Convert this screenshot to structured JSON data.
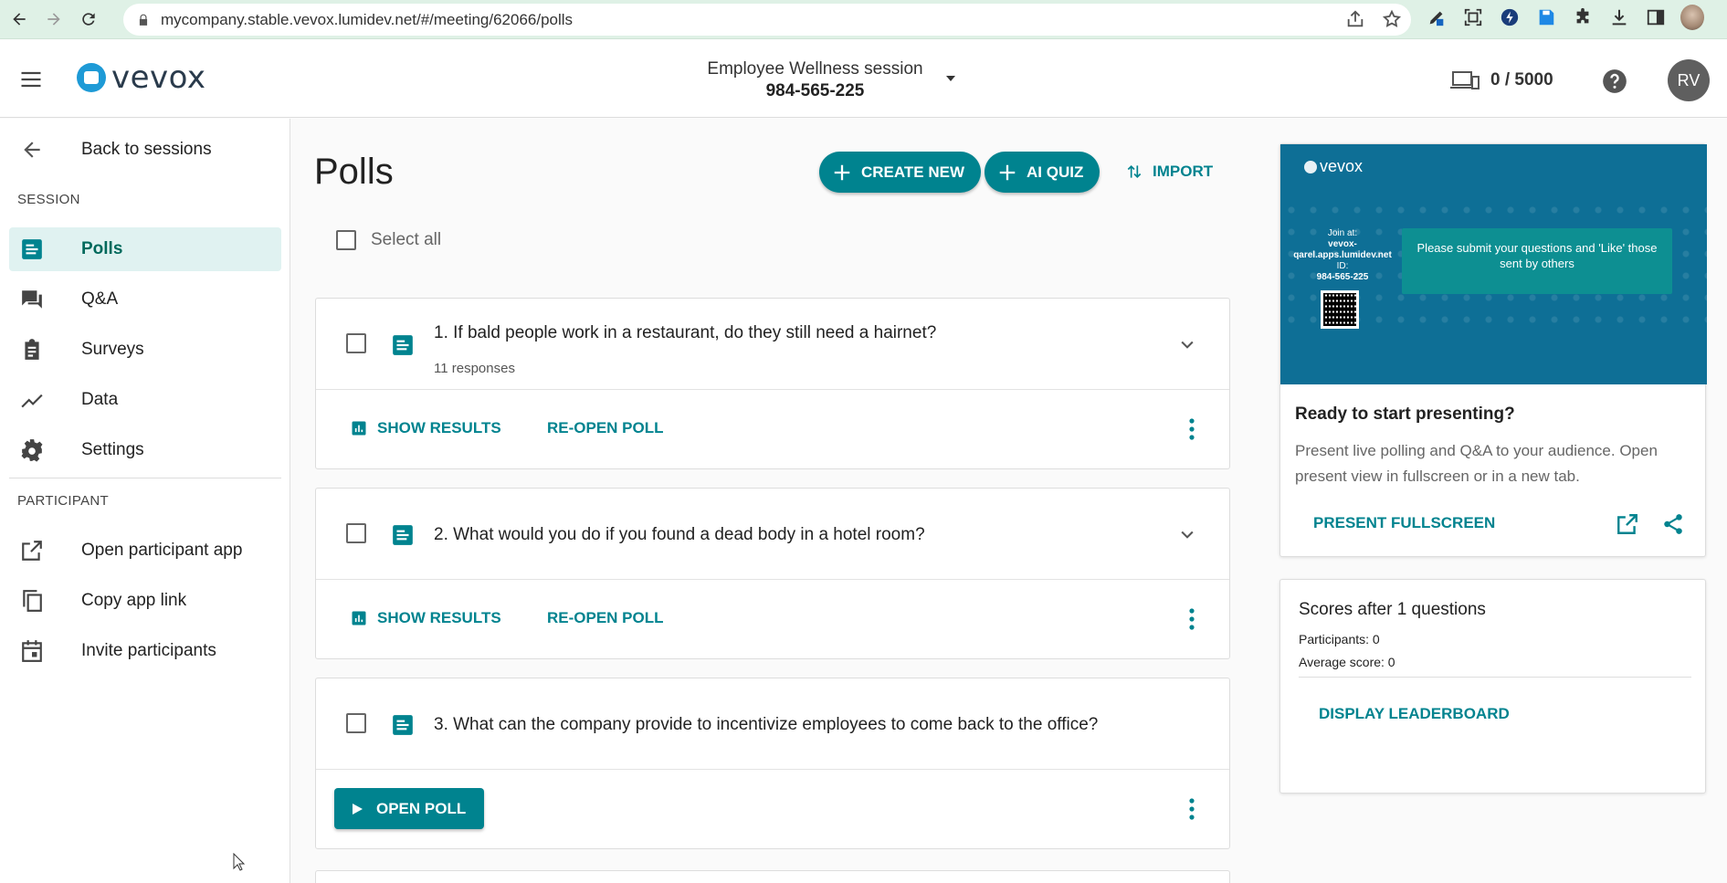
{
  "browser": {
    "url": "mycompany.stable.vevox.lumidev.net/#/meeting/62066/polls"
  },
  "header": {
    "logo_text": "vevox",
    "session_name": "Employee Wellness session",
    "session_code": "984-565-225",
    "devices_count": "0 / 5000",
    "avatar_initials": "RV"
  },
  "sidebar": {
    "back_label": "Back to sessions",
    "session_heading": "SESSION",
    "items": [
      {
        "label": "Polls",
        "icon": "poll-icon"
      },
      {
        "label": "Q&A",
        "icon": "forum-icon"
      },
      {
        "label": "Surveys",
        "icon": "clipboard-icon"
      },
      {
        "label": "Data",
        "icon": "trend-icon"
      },
      {
        "label": "Settings",
        "icon": "gear-icon"
      }
    ],
    "participant_heading": "PARTICIPANT",
    "participant_items": [
      {
        "label": "Open participant app",
        "icon": "open-external-icon"
      },
      {
        "label": "Copy app link",
        "icon": "copy-icon"
      },
      {
        "label": "Invite participants",
        "icon": "calendar-icon"
      }
    ]
  },
  "main": {
    "title": "Polls",
    "create_new_label": "CREATE NEW",
    "ai_quiz_label": "AI QUIZ",
    "import_label": "IMPORT",
    "select_all_label": "Select all",
    "polls": [
      {
        "question": "1. If bald people work in a restaurant, do they still need a hairnet?",
        "responses": "11 responses",
        "show_results": "SHOW RESULTS",
        "reopen": "RE-OPEN POLL"
      },
      {
        "question": "2. What would you do if you found a dead body in a hotel room?",
        "show_results": "SHOW RESULTS",
        "reopen": "RE-OPEN POLL"
      },
      {
        "question": "3. What can the company provide to incentivize employees to come back to the office?",
        "open_poll": "OPEN POLL"
      }
    ]
  },
  "present": {
    "preview_logo": "vevox",
    "preview_join_at": "Join at:",
    "preview_join_url": "vevox-qarel.apps.lumidev.net",
    "preview_id_label": "ID:",
    "preview_id": "984-565-225",
    "preview_banner": "Please submit your questions and 'Like' those sent by others",
    "ready_title": "Ready to start presenting?",
    "ready_desc": "Present live polling and Q&A to your audience. Open present view in fullscreen or in a new tab.",
    "fullscreen_label": "PRESENT FULLSCREEN"
  },
  "scores": {
    "title": "Scores after 1 questions",
    "participants": "Participants: 0",
    "average": "Average score: 0",
    "leaderboard_label": "DISPLAY LEADERBOARD"
  },
  "colors": {
    "accent": "#00838f",
    "active_bg": "#e0f2f1",
    "preview_bg": "#0e6f96"
  }
}
